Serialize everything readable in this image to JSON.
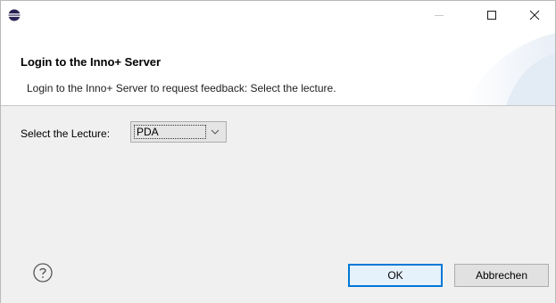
{
  "window": {
    "app_icon": "eclipse-icon",
    "controls": {
      "minimize": "minimize-icon",
      "maximize": "maximize-icon",
      "close": "close-icon"
    }
  },
  "banner": {
    "title": "Login to the Inno+ Server",
    "description": "Login to the Inno+ Server to request feedback: Select the lecture."
  },
  "form": {
    "lecture_label": "Select the Lecture:",
    "lecture_value": "PDA"
  },
  "footer": {
    "help_icon": "help-icon",
    "ok_label": "OK",
    "cancel_label": "Abbrechen"
  },
  "colors": {
    "accent": "#0078d7",
    "dialog_bg": "#f0f0f0",
    "banner_bg": "#ffffff"
  }
}
